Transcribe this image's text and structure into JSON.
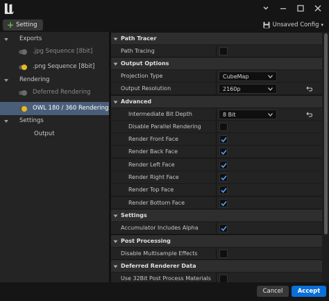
{
  "window": {
    "minimize_label": "",
    "controls": [
      "chevron-down-icon",
      "minimize-icon",
      "maximize-icon",
      "close-icon"
    ]
  },
  "toolbar": {
    "setting_label": "Setting",
    "config_label": "Unsaved Config",
    "config_caret": "▾"
  },
  "tree": {
    "exports_label": "Exports",
    "jpg_label": ".jpg Sequence [8bit]",
    "png_label": ".png Sequence [8bit]",
    "rendering_label": "Rendering",
    "deferred_label": "Deferred Rendering",
    "owl_label": "OWL 180 / 360 Rendering",
    "settings_label": "Settings",
    "output_label": "Output"
  },
  "sections": {
    "path_tracer": "Path Tracer",
    "output_options": "Output Options",
    "advanced": "Advanced",
    "settings": "Settings",
    "post_processing": "Post Processing",
    "deferred_data": "Deferred Renderer Data"
  },
  "props": {
    "path_tracing": {
      "label": "Path Tracing",
      "checked": false
    },
    "projection_type": {
      "label": "Projection Type",
      "value": "CubeMap"
    },
    "output_resolution": {
      "label": "Output Resolution",
      "value": "2160p"
    },
    "bit_depth": {
      "label": "Intermediate Bit Depth",
      "value": "8 Bit"
    },
    "disable_parallel": {
      "label": "Disable Parallel Rendering",
      "checked": false
    },
    "front": {
      "label": "Render Front Face",
      "checked": true
    },
    "back": {
      "label": "Render Back Face",
      "checked": true
    },
    "left": {
      "label": "Render Left Face",
      "checked": true
    },
    "right": {
      "label": "Render Right Face",
      "checked": true
    },
    "top": {
      "label": "Render Top Face",
      "checked": true
    },
    "bottom": {
      "label": "Render Bottom Face",
      "checked": true
    },
    "accumulator_alpha": {
      "label": "Accumulator Includes Alpha",
      "checked": true
    },
    "disable_msaa": {
      "label": "Disable Multisample Effects",
      "checked": false
    },
    "use_32bit": {
      "label": "Use 32Bit Post Process Materials",
      "checked": false
    }
  },
  "footer": {
    "cancel_label": "Cancel",
    "accept_label": "Accept"
  },
  "colors": {
    "accent_blue": "#0a6fd8",
    "selection": "#4a5e79",
    "toggle_on": "#e8b820",
    "check": "#4ea3ff"
  }
}
